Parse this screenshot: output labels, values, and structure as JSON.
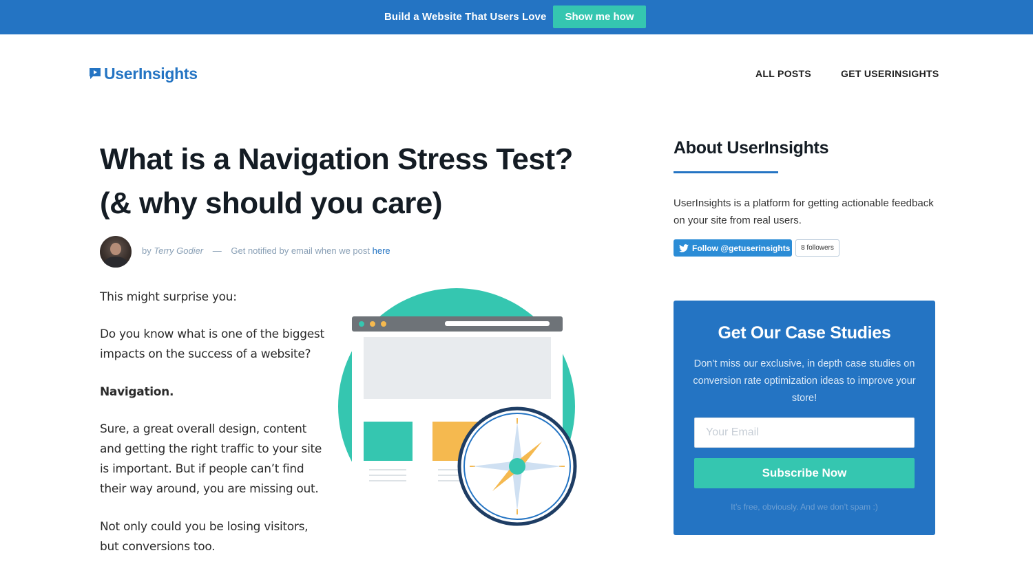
{
  "topbar": {
    "text": "Build a Website That Users Love",
    "button_label": "Show me how"
  },
  "header": {
    "logo_text": "UserInsights",
    "nav": [
      {
        "label": "ALL POSTS"
      },
      {
        "label": "GET USERINSIGHTS"
      }
    ]
  },
  "article": {
    "title_line1": "What is a Navigation Stress Test?",
    "title_line2": "(& why should you care)",
    "byline": {
      "by": "by",
      "author": "Terry Godier",
      "separator": "—",
      "notify_text": "Get notified by email when we post",
      "notify_link": "here"
    },
    "paragraphs": [
      "This might surprise you:",
      "Do you know what is one of the biggest impacts on the success of a website?",
      "Navigation.",
      "Sure, a great overall design, content and getting the right traffic to your site is important. But if people can’t find their way around, you are missing out.",
      "Not only could you be losing visitors, but conversions too."
    ]
  },
  "sidebar": {
    "about_title": "About UserInsights",
    "about_text": "UserInsights is a platform for getting actionable feedback on your site from real users.",
    "twitter_follow": "Follow @getuserinsights",
    "twitter_followers": "8 followers",
    "cta": {
      "title": "Get Our Case Studies",
      "description": "Don’t miss our exclusive, in depth case studies on conversion rate optimization ideas to improve your store!",
      "email_placeholder": "Your Email",
      "submit_label": "Subscribe Now",
      "footnote": "It’s free, obviously. And we don’t spam :)"
    }
  },
  "colors": {
    "brand_blue": "#2474c3",
    "accent_teal": "#35c6b0",
    "accent_orange": "#f5b94f"
  }
}
